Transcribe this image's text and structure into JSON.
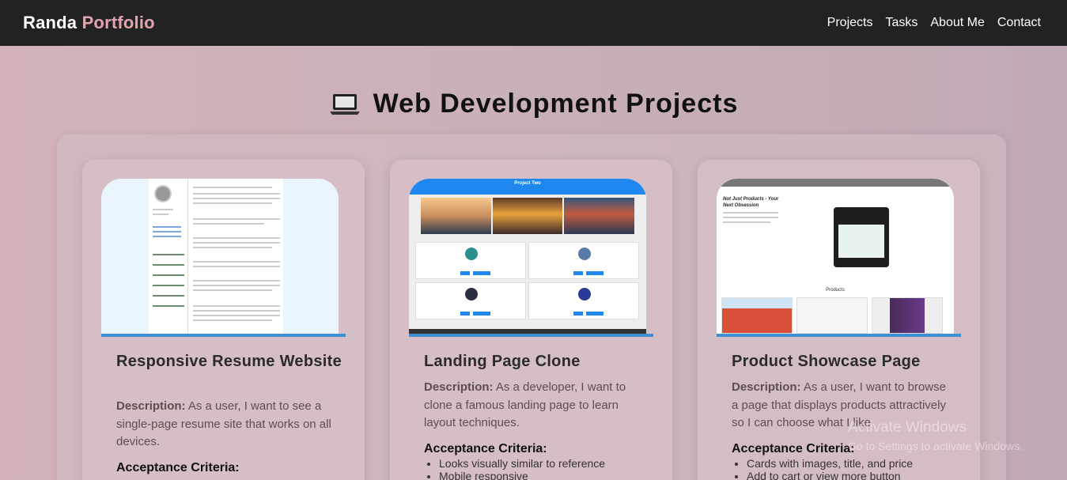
{
  "navbar": {
    "brand_first": "Randa",
    "brand_second": "Portfolio",
    "links": [
      "Projects",
      "Tasks",
      "About Me",
      "Contact"
    ]
  },
  "page": {
    "heading": "Web Development Projects"
  },
  "cards": [
    {
      "title": "Responsive Resume Website",
      "desc_label": "Description:",
      "desc_text": " As a user, I want to see a single-page resume site that works on all devices.",
      "ac_title": "Acceptance Criteria:",
      "criteria": []
    },
    {
      "title": "Landing Page Clone",
      "desc_label": "Description:",
      "desc_text": " As a developer, I want to clone a famous landing page to learn layout techniques.",
      "ac_title": "Acceptance Criteria:",
      "criteria": [
        "Looks visually similar to reference",
        "Mobile responsive"
      ],
      "thumb_title": "Project Two"
    },
    {
      "title": "Product Showcase Page",
      "desc_label": "Description:",
      "desc_text": " As a user, I want to browse a page that displays products attractively so I can choose what I like",
      "ac_title": "Acceptance Criteria:",
      "criteria": [
        "Cards with images, title, and price",
        "Add to cart or view more button"
      ],
      "thumb_headline": "Not Just Products - Your Next Obsession",
      "thumb_section": "Products"
    }
  ],
  "watermark": {
    "line1": "Activate Windows",
    "line2": "Go to Settings to activate Windows."
  },
  "colors": {
    "navbar_bg": "#222222",
    "brand_accent": "#e2a4ad",
    "thumb_bar": "#3f8fd6"
  }
}
